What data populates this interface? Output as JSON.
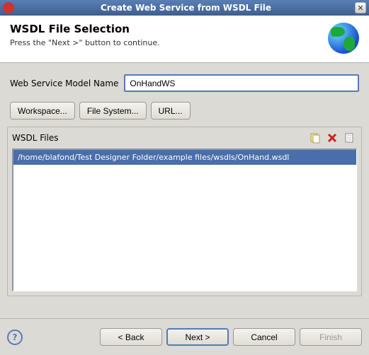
{
  "window": {
    "title": "Create Web Service from WSDL File"
  },
  "header": {
    "title": "WSDL File Selection",
    "subtitle": "Press the \"Next >\" button to continue."
  },
  "form": {
    "model_name_label": "Web Service Model Name",
    "model_name_value": "OnHandWS"
  },
  "buttons": {
    "workspace": "Workspace...",
    "filesystem": "File System...",
    "url": "URL..."
  },
  "group": {
    "label": "WSDL Files",
    "items": [
      "/home/blafond/Test Designer Folder/example files/wsdls/OnHand.wsdl"
    ]
  },
  "icons": {
    "copy": "copy-icon",
    "delete": "delete-icon",
    "new": "new-file-icon"
  },
  "footer": {
    "back": "< Back",
    "next": "Next >",
    "cancel": "Cancel",
    "finish": "Finish"
  }
}
